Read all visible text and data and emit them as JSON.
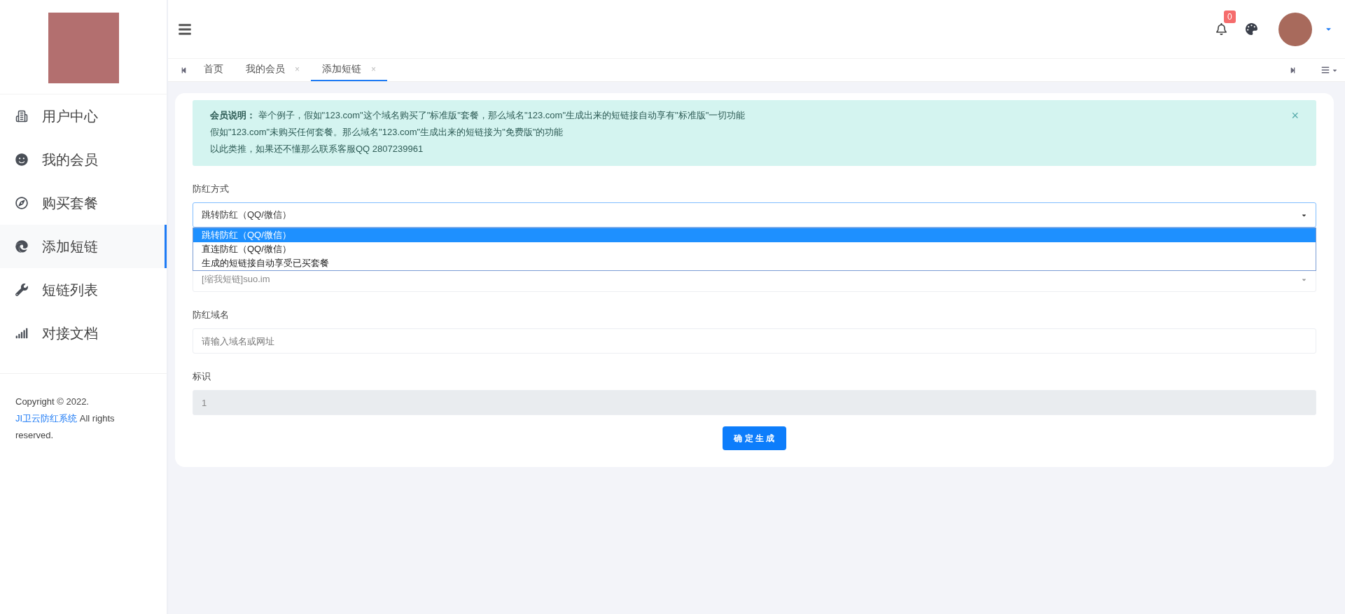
{
  "sidebar": {
    "items": [
      {
        "label": "用户中心",
        "selected": false
      },
      {
        "label": "我的会员",
        "selected": false
      },
      {
        "label": "购买套餐",
        "selected": false
      },
      {
        "label": "添加短链",
        "selected": true
      },
      {
        "label": "短链列表",
        "selected": false
      },
      {
        "label": "对接文档",
        "selected": false
      }
    ],
    "footer": {
      "text_before": "Copyright © 2022.",
      "link": "JI卫云防红系统",
      "text_after": "All rights reserved."
    }
  },
  "header": {
    "notification_count": "0"
  },
  "tabs": [
    {
      "label": "首页",
      "selected": false
    },
    {
      "label": "我的会员",
      "selected": false,
      "close": "×"
    },
    {
      "label": "添加短链",
      "selected": true,
      "close": "×"
    }
  ],
  "alert": {
    "close": "×",
    "lines": [
      "**会员说明：** 举个例子，假如\"123.com\"这个域名购买了\"标准版\"套餐，那么域名\"123.com\"生成出来的短链接自动享有\"标准版\"一切功能",
      "假如\"123.com\"未购买任何套餐。那么域名\"123.com\"生成出来的短链接为\"免费版\"的功能",
      "以此类推，如果还不懂那么联系客服QQ 2807239961"
    ]
  },
  "form": {
    "fields": [
      {
        "kind": "select",
        "label": "防红方式",
        "value": "跳转防红（QQ/微信）",
        "open": true,
        "options": [
          {
            "label": "跳转防红（QQ/微信）",
            "selected": true
          },
          {
            "label": "直连防红（QQ/微信）",
            "selected": false
          },
          {
            "label": "生成的短链接自动享受已买套餐",
            "selected": false
          }
        ]
      },
      {
        "kind": "select",
        "value": "[缩我短链]suo.im",
        "open": false
      },
      {
        "kind": "text",
        "label": "防红域名",
        "placeholder": "请输入域名或网址"
      },
      {
        "kind": "readonly",
        "label": "标识",
        "value": "1"
      }
    ],
    "submit": "确 定 生 成"
  }
}
